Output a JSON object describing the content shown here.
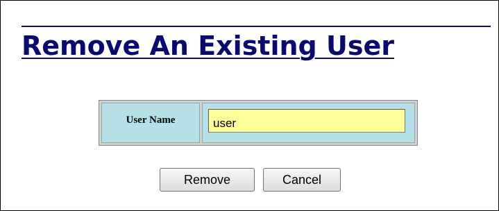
{
  "page": {
    "title": "Remove An Existing User"
  },
  "form": {
    "username_label": "User Name",
    "username_value": "user"
  },
  "buttons": {
    "remove_label": "Remove",
    "cancel_label": "Cancel"
  },
  "colors": {
    "title": "#0a0a6e",
    "label_cell_bg": "#b6dfe8",
    "input_bg": "#ffff99"
  }
}
